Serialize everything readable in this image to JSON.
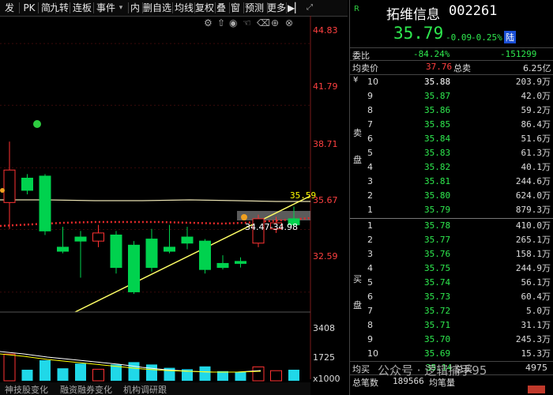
{
  "toolbar": {
    "items": [
      "发",
      "PK",
      "简",
      "九转",
      "连板",
      "事件",
      "内",
      "删自选",
      "均线",
      "复权",
      "叠",
      "窗",
      "预测",
      "更多"
    ],
    "right_icons": [
      "gear-icon",
      "up-icon",
      "eye-icon",
      "hand-icon",
      "trash-icon",
      "plus-circle-icon",
      "close-circle-icon"
    ]
  },
  "price_axis": {
    "labels": [
      "44.83",
      "41.79",
      "38.71",
      "35.67",
      "32.59"
    ],
    "price_marker": "35.59",
    "range_label": "34.47-34.98"
  },
  "volume_axis": {
    "labels": [
      "3408",
      "1725",
      "x1000"
    ]
  },
  "bottom_tabs": [
    "神技股变化",
    "融资融券变化",
    "机构调研跟"
  ],
  "chart_data": {
    "type": "candlestick",
    "series": [
      {
        "open": 37.0,
        "close": 38.6,
        "high": 40.0,
        "low": 35.7
      },
      {
        "open": 38.2,
        "close": 37.6,
        "high": 38.4,
        "low": 37.4
      },
      {
        "open": 38.3,
        "close": 35.6,
        "high": 38.4,
        "low": 35.4
      },
      {
        "open": 34.8,
        "close": 34.6,
        "high": 35.8,
        "low": 34.5
      },
      {
        "open": 35.3,
        "close": 35.1,
        "high": 35.6,
        "low": 33.3
      },
      {
        "open": 35.1,
        "close": 35.5,
        "high": 35.9,
        "low": 34.8
      },
      {
        "open": 35.4,
        "close": 33.8,
        "high": 35.6,
        "low": 33.5
      },
      {
        "open": 34.9,
        "close": 32.6,
        "high": 35.1,
        "low": 32.5
      },
      {
        "open": 35.2,
        "close": 33.8,
        "high": 35.7,
        "low": 33.6
      },
      {
        "open": 34.8,
        "close": 34.6,
        "high": 35.9,
        "low": 34.5
      },
      {
        "open": 35.3,
        "close": 35.0,
        "high": 35.8,
        "low": 34.7
      },
      {
        "open": 35.1,
        "close": 33.7,
        "high": 35.2,
        "low": 33.5
      },
      {
        "open": 34.0,
        "close": 33.8,
        "high": 34.4,
        "low": 33.7
      },
      {
        "open": 34.1,
        "close": 34.0,
        "high": 34.3,
        "low": 33.8
      },
      {
        "open": 35.0,
        "close": 36.2,
        "high": 36.4,
        "low": 34.8
      },
      {
        "open": 35.7,
        "close": 36.0,
        "high": 36.3,
        "low": 35.5
      },
      {
        "open": 36.2,
        "close": 35.9,
        "high": 36.8,
        "low": 35.8
      }
    ],
    "y_range": [
      31.8,
      46.0
    ]
  },
  "header": {
    "code_letter": "R",
    "name": "拓维信息",
    "code": "002261",
    "price": "35.79",
    "change": "-0.09",
    "change_pct": "-0.25%",
    "tag": "陆"
  },
  "stats": {
    "weibi_label": "委比",
    "weibi_value": "-84.24%",
    "weibi_diff": "-151299",
    "avg_label": "均卖价",
    "avg_value": "37.76",
    "total_label": "总卖",
    "total_value": "6.25亿"
  },
  "asks": {
    "label_char1": "卖",
    "label_char2": "盘",
    "yen": "¥",
    "rows": [
      {
        "level": "10",
        "price": "35.88",
        "vol": "203.9万"
      },
      {
        "level": "9",
        "price": "35.87",
        "vol": "42.0万"
      },
      {
        "level": "8",
        "price": "35.86",
        "vol": "59.2万"
      },
      {
        "level": "7",
        "price": "35.85",
        "vol": "86.4万"
      },
      {
        "level": "6",
        "price": "35.84",
        "vol": "51.6万"
      },
      {
        "level": "5",
        "price": "35.83",
        "vol": "61.3万"
      },
      {
        "level": "4",
        "price": "35.82",
        "vol": "40.1万"
      },
      {
        "level": "3",
        "price": "35.81",
        "vol": "244.6万"
      },
      {
        "level": "2",
        "price": "35.80",
        "vol": "624.0万"
      },
      {
        "level": "1",
        "price": "35.79",
        "vol": "879.3万"
      }
    ]
  },
  "bids": {
    "label_char1": "买",
    "label_char2": "盘",
    "rows": [
      {
        "level": "1",
        "price": "35.78",
        "vol": "410.0万"
      },
      {
        "level": "2",
        "price": "35.77",
        "vol": "265.1万"
      },
      {
        "level": "3",
        "price": "35.76",
        "vol": "158.1万"
      },
      {
        "level": "4",
        "price": "35.75",
        "vol": "244.9万"
      },
      {
        "level": "5",
        "price": "35.74",
        "vol": "56.1万"
      },
      {
        "level": "6",
        "price": "35.73",
        "vol": "60.4万"
      },
      {
        "level": "7",
        "price": "35.72",
        "vol": "5.0万"
      },
      {
        "level": "8",
        "price": "35.71",
        "vol": "31.1万"
      },
      {
        "level": "9",
        "price": "35.70",
        "vol": "245.3万"
      },
      {
        "level": "10",
        "price": "35.69",
        "vol": "15.3万"
      }
    ]
  },
  "bottom_stats": {
    "avg_buy_label": "均买",
    "avg_buy_value": "35.14",
    "total_buy_label": "总买",
    "total_buy_value": "4975",
    "total_count_label": "总笔数",
    "total_count_value": "189566",
    "avg_count_label": "均笔量"
  },
  "watermark": "公众号 · 逻辑捕手95",
  "colors": {
    "up": "#ff3232",
    "down": "#00d24e",
    "yellow": "#ffff00",
    "bg": "#000000",
    "axis_text": "#ff4040"
  }
}
